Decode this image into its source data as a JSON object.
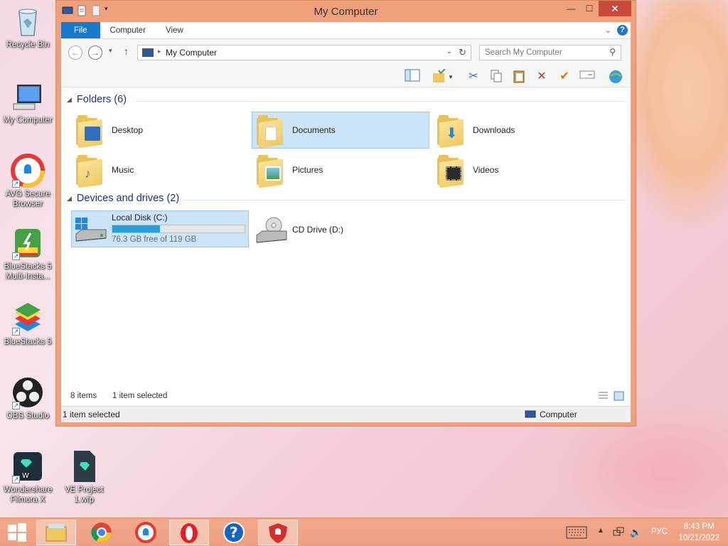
{
  "desktop": {
    "icons": [
      {
        "label": "Recycle Bin"
      },
      {
        "label": "My Computer"
      },
      {
        "label": "AVG Secure Browser"
      },
      {
        "label": "BlueStacks 5 Multi-Insta..."
      },
      {
        "label": "BlueStacks 5"
      },
      {
        "label": "OBS Studio"
      },
      {
        "label": "Wondershare Filmora X"
      },
      {
        "label": "VE Project 1.wfp"
      }
    ]
  },
  "window": {
    "title": "My Computer",
    "controls": {
      "minimize": "—",
      "maximize": "☐",
      "close": "✕"
    },
    "ribbon_tabs": [
      "File",
      "Computer",
      "View"
    ],
    "address": {
      "path": "My Computer"
    },
    "search": {
      "placeholder": "Search My Computer"
    },
    "groups": {
      "folders": "Folders (6)",
      "devices": "Devices and drives (2)"
    },
    "folders": [
      {
        "name": "Desktop",
        "selected": false
      },
      {
        "name": "Documents",
        "selected": true
      },
      {
        "name": "Downloads",
        "selected": false
      },
      {
        "name": "Music",
        "selected": false
      },
      {
        "name": "Pictures",
        "selected": false
      },
      {
        "name": "Videos",
        "selected": false
      }
    ],
    "drives": [
      {
        "name": "Local Disk (C:)",
        "free_text": "76.3 GB free of 119 GB",
        "used_fraction": 0.36,
        "selected": true
      },
      {
        "name": "CD Drive (D:)",
        "selected": false
      }
    ],
    "status": {
      "item_count": "8 items",
      "selected": "1 item selected"
    },
    "details": {
      "selected": "1 item selected",
      "location": "Computer"
    }
  },
  "taskbar": {
    "language": "РУС",
    "time": "8:43 PM",
    "date": "10/21/2022"
  },
  "colors": {
    "accent": "#1979ca",
    "window_frame": "#f0a07a",
    "selection": "#cce4f7",
    "progress": "#26a0da"
  }
}
